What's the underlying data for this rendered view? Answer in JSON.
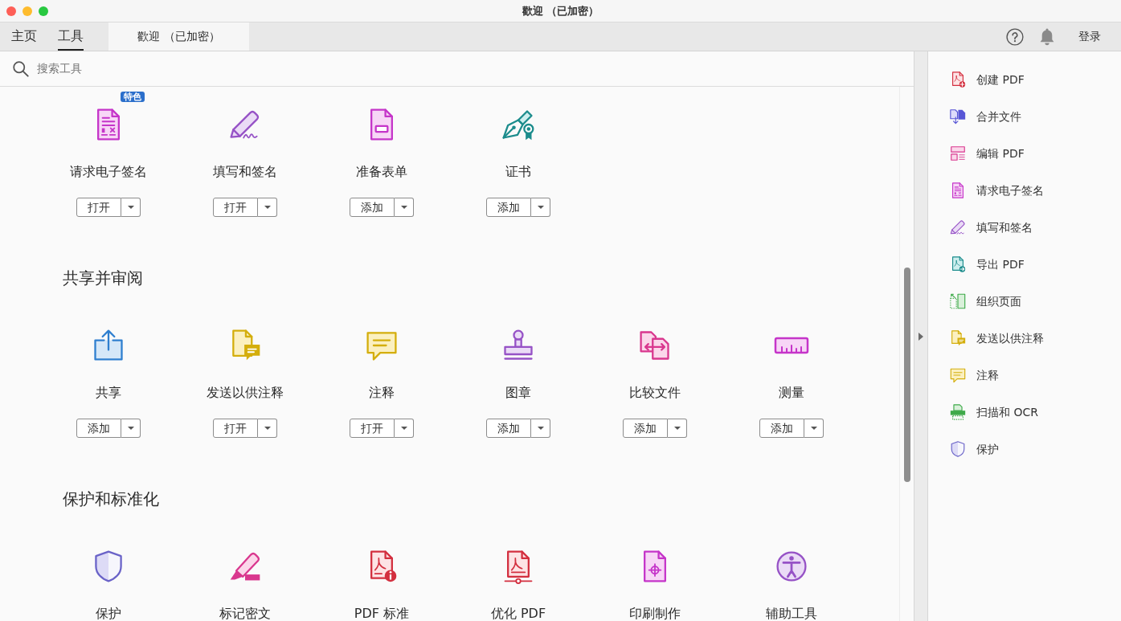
{
  "window": {
    "title": "歡迎 （已加密）"
  },
  "tabs": [
    {
      "label": "主页",
      "selected": false
    },
    {
      "label": "工具",
      "selected": true
    }
  ],
  "document_tab": {
    "label": "歡迎 （已加密）"
  },
  "header": {
    "sign_in": "登录"
  },
  "search": {
    "placeholder": "搜索工具"
  },
  "sections": [
    {
      "tools": [
        {
          "label": "请求电子签名",
          "badge": "特色",
          "button": "打开"
        },
        {
          "label": "填写和签名",
          "button": "打开"
        },
        {
          "label": "准备表单",
          "button": "添加"
        },
        {
          "label": "证书",
          "button": "添加"
        }
      ]
    },
    {
      "title": "共享并审阅",
      "tools": [
        {
          "label": "共享",
          "button": "添加"
        },
        {
          "label": "发送以供注释",
          "button": "打开"
        },
        {
          "label": "注释",
          "button": "打开"
        },
        {
          "label": "图章",
          "button": "添加"
        },
        {
          "label": "比较文件",
          "button": "添加"
        },
        {
          "label": "测量",
          "button": "添加"
        }
      ]
    },
    {
      "title": "保护和标准化",
      "tools": [
        {
          "label": "保护"
        },
        {
          "label": "标记密文"
        },
        {
          "label": "PDF 标准"
        },
        {
          "label": "优化 PDF"
        },
        {
          "label": "印刷制作"
        },
        {
          "label": "辅助工具"
        }
      ]
    }
  ],
  "side_panel": {
    "items": [
      {
        "label": "创建 PDF"
      },
      {
        "label": "合并文件"
      },
      {
        "label": "编辑 PDF"
      },
      {
        "label": "请求电子签名"
      },
      {
        "label": "填写和签名"
      },
      {
        "label": "导出 PDF"
      },
      {
        "label": "组织页面"
      },
      {
        "label": "发送以供注释"
      },
      {
        "label": "注释"
      },
      {
        "label": "扫描和 OCR"
      },
      {
        "label": "保护"
      }
    ]
  }
}
